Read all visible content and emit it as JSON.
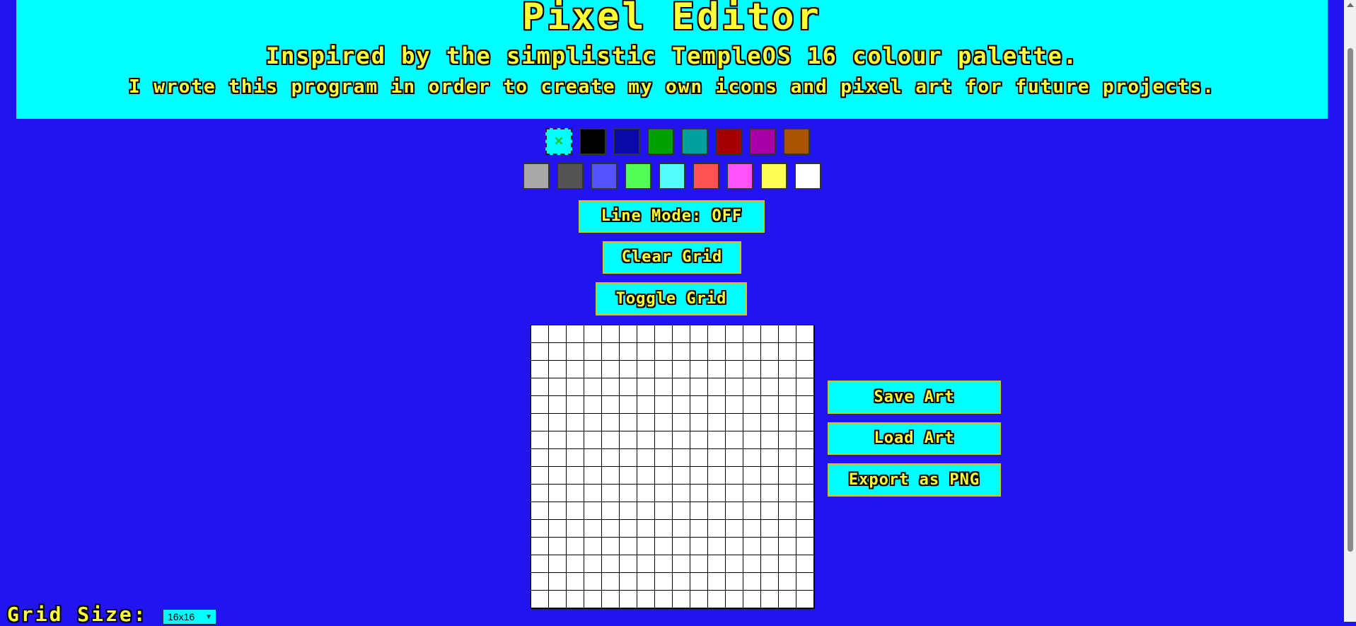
{
  "header": {
    "title": "Pixel Editor",
    "subtitle": "Inspired by the simplistic TempleOS 16 colour palette.",
    "description": "I wrote this program in order to create my own icons and pixel art for future projects."
  },
  "palette": {
    "eraser_symbol": "×",
    "row1": [
      "#000000",
      "#0a0aa8",
      "#00a000",
      "#00a0a0",
      "#a80000",
      "#a800a8",
      "#a85400"
    ],
    "row2": [
      "#a8a8a8",
      "#545454",
      "#5454fe",
      "#54fe54",
      "#54fefe",
      "#fe5454",
      "#fe54fe",
      "#fefe54",
      "#ffffff"
    ]
  },
  "controls": {
    "line_mode": "Line Mode: OFF",
    "clear_grid": "Clear Grid",
    "toggle_grid": "Toggle Grid",
    "save_art": "Save Art",
    "load_art": "Load Art",
    "export_png": "Export as PNG"
  },
  "grid_size": {
    "label": "Grid Size:",
    "selected": "16x16",
    "icon": "chevron-down-icon"
  },
  "colors": {
    "background": "#2114ef",
    "accent": "#00ffff",
    "text": "#ffff33"
  }
}
